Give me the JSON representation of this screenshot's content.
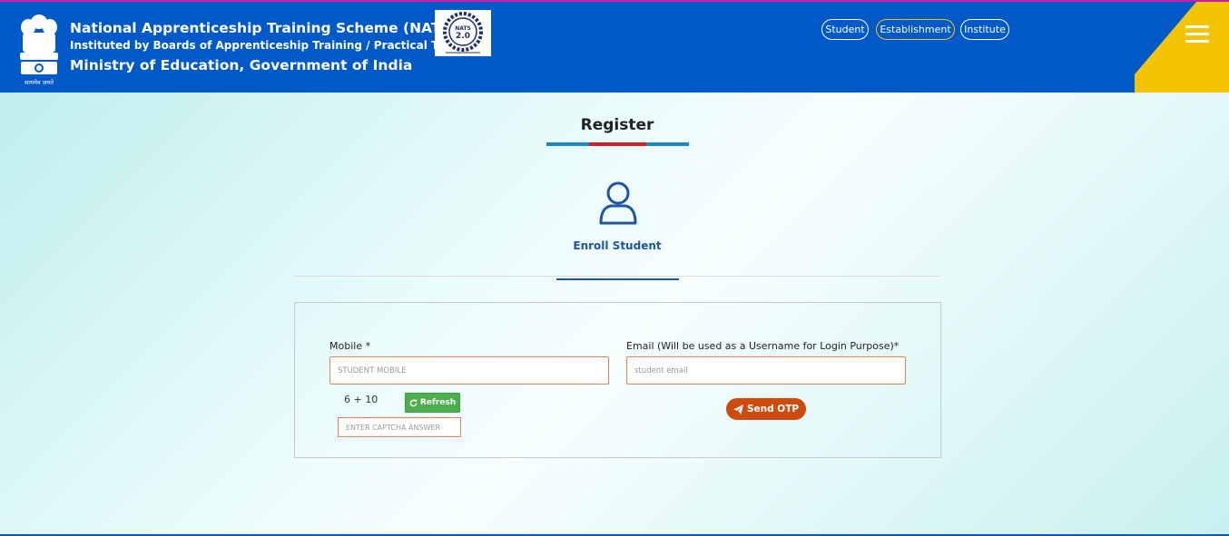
{
  "header": {
    "title_line1": "National Apprenticeship Training Scheme (NATS)",
    "title_line2": "Instituted by Boards of Apprenticeship Training / Practical Training",
    "title_line3": "Ministry of Education, Government of India",
    "emblem_caption": "सत्यमेव जयते",
    "logo_text": "NATS 2.0",
    "nav": [
      {
        "label": "Student"
      },
      {
        "label": "Establishment"
      },
      {
        "label": "Institute"
      }
    ],
    "menu_icon": "hamburger-icon",
    "colors": {
      "primary": "#0059c9",
      "accent": "#f5c400"
    }
  },
  "page": {
    "title": "Register",
    "tab_label": "Enroll Student",
    "tab_icon": "user-icon"
  },
  "form": {
    "mobile_label": "Mobile *",
    "mobile_placeholder": "STUDENT MOBILE",
    "email_label": "Email (Will be used as a Username for Login Purpose)*",
    "email_placeholder": "student email",
    "captcha_question": "6 + 10",
    "refresh_label": "Refresh",
    "captcha_placeholder": "ENTER CAPTCHA ANSWER",
    "send_otp_label": "Send OTP",
    "colors": {
      "refresh": "#4cae4c",
      "send_otp": "#cf4a0d",
      "input_border": "#e8835a"
    }
  }
}
